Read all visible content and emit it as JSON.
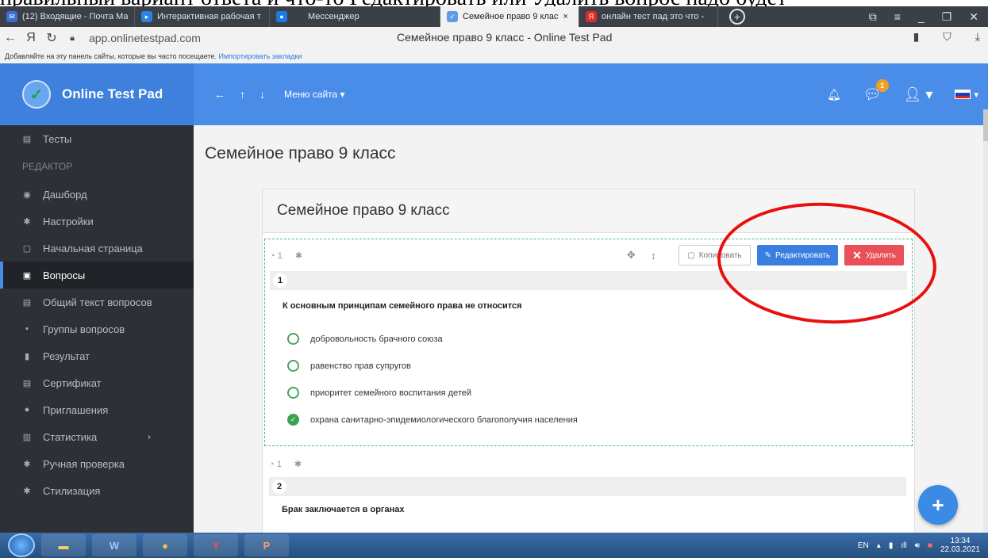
{
  "top_text": "правильный вариант ответа и что-то Редактировать или Удалить вопрос надо будет",
  "browser": {
    "tabs": [
      {
        "label": "(12) Входящие - Почта Ма",
        "fav_color": "#3d6fd1",
        "fav_glyph": "✉"
      },
      {
        "label": "Интерактивная рабочая т",
        "fav_color": "#2a84e0",
        "fav_glyph": "▸"
      },
      {
        "label": "Мессенджер",
        "fav_color": "#1a7be8",
        "fav_glyph": "●"
      },
      {
        "label": "Семейное право 9 клас",
        "fav_color": "#5e9be8",
        "fav_glyph": "✓",
        "active": true
      },
      {
        "label": "онлайн тест пад это что -",
        "fav_color": "#e22a2a",
        "fav_glyph": "Я"
      }
    ],
    "close_glyph": "×",
    "url": "app.onlinetestpad.com",
    "page_title": "Семейное право 9 класс - Online Test Pad",
    "bookmarks_text": "Добавляйте на эту панель сайты, которые вы часто посещаете.",
    "bookmarks_link": "Импортировать закладки"
  },
  "header": {
    "brand": "Online Test Pad",
    "menu": "Меню сайта ▾",
    "chat_badge": "1"
  },
  "sidebar": {
    "items": [
      {
        "label": "Тесты",
        "icon": "▤"
      },
      {
        "label": "Дашборд",
        "icon": "◉"
      },
      {
        "label": "Настройки",
        "icon": "✱"
      },
      {
        "label": "Начальная страница",
        "icon": "▢"
      },
      {
        "label": "Вопросы",
        "icon": "▣"
      },
      {
        "label": "Общий текст вопросов",
        "icon": "▤"
      },
      {
        "label": "Группы вопросов",
        "icon": "▪"
      },
      {
        "label": "Результат",
        "icon": "▮"
      },
      {
        "label": "Сертификат",
        "icon": "▤"
      },
      {
        "label": "Приглашения",
        "icon": "●"
      },
      {
        "label": "Статистика",
        "icon": "▥"
      },
      {
        "label": "Ручная проверка",
        "icon": "✱"
      },
      {
        "label": "Стилизация",
        "icon": "✱"
      }
    ],
    "section": "РЕДАКТОР"
  },
  "main": {
    "page_title": "Семейное право 9 класс",
    "card_title": "Семейное право 9 класс",
    "buttons": {
      "copy": "Копировать",
      "edit": "Редактировать",
      "delete": "Удалить"
    },
    "question1": {
      "meta_count": "1",
      "number": "1",
      "text": "К основным принципам семейного права не относится",
      "answers": [
        {
          "text": "добровольность брачного союза",
          "checked": false
        },
        {
          "text": "равенство прав супругов",
          "checked": false
        },
        {
          "text": "приоритет семейного воспитания детей",
          "checked": false
        },
        {
          "text": "охрана санитарно-эпидемиологического благополучия населения",
          "checked": true
        }
      ]
    },
    "question2": {
      "meta_count": "1",
      "number": "2",
      "text": "Брак заключается в органах"
    }
  },
  "taskbar": {
    "lang": "EN",
    "time": "13:34",
    "date": "22.03.2021"
  }
}
